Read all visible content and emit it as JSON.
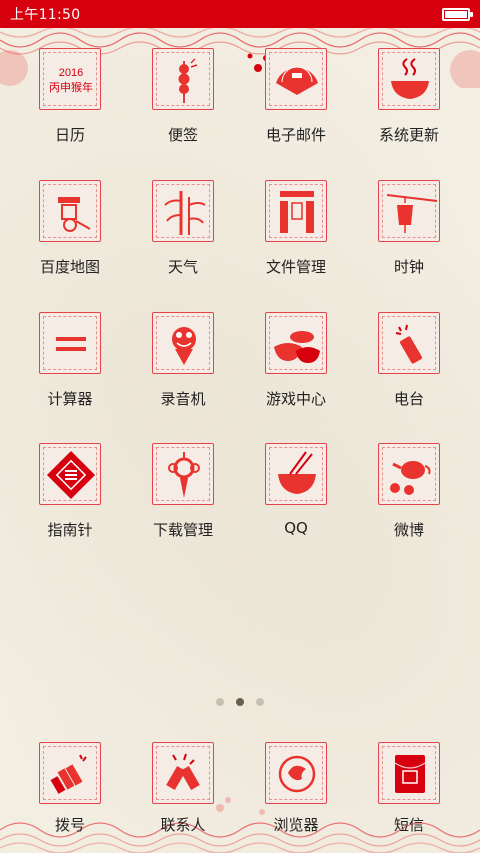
{
  "status_bar": {
    "time": "上午11:50",
    "battery_level": 1.0
  },
  "theme": {
    "accent": "#d7000f",
    "tile_border": "#e5424a",
    "background": "#f3eee2"
  },
  "apps": [
    {
      "label": "日历",
      "icon": "calendar-icon",
      "calendar_year": "2016",
      "calendar_text": "丙申猴年"
    },
    {
      "label": "便签",
      "icon": "candied-haws-icon"
    },
    {
      "label": "电子邮件",
      "icon": "fan-mail-icon"
    },
    {
      "label": "系统更新",
      "icon": "steaming-bowl-icon"
    },
    {
      "label": "百度地图",
      "icon": "rickshaw-icon"
    },
    {
      "label": "天气",
      "icon": "bamboo-icon"
    },
    {
      "label": "文件管理",
      "icon": "couplets-icon"
    },
    {
      "label": "时钟",
      "icon": "lantern-icon"
    },
    {
      "label": "计算器",
      "icon": "equals-icon"
    },
    {
      "label": "录音机",
      "icon": "fish-icon"
    },
    {
      "label": "游戏中心",
      "icon": "gold-ingot-icon"
    },
    {
      "label": "电台",
      "icon": "firecracker-icon"
    },
    {
      "label": "指南针",
      "icon": "fu-diamond-icon"
    },
    {
      "label": "下载管理",
      "icon": "chinese-knot-icon"
    },
    {
      "label": "QQ",
      "icon": "noodle-bowl-icon"
    },
    {
      "label": "微博",
      "icon": "teapot-icon"
    }
  ],
  "page_indicator": {
    "pages": 3,
    "current": 2
  },
  "dock": [
    {
      "label": "拨号",
      "icon": "firecracker-bundle-icon"
    },
    {
      "label": "联系人",
      "icon": "firecrackers-icon"
    },
    {
      "label": "浏览器",
      "icon": "swirl-circle-icon"
    },
    {
      "label": "短信",
      "icon": "red-envelope-icon"
    }
  ]
}
